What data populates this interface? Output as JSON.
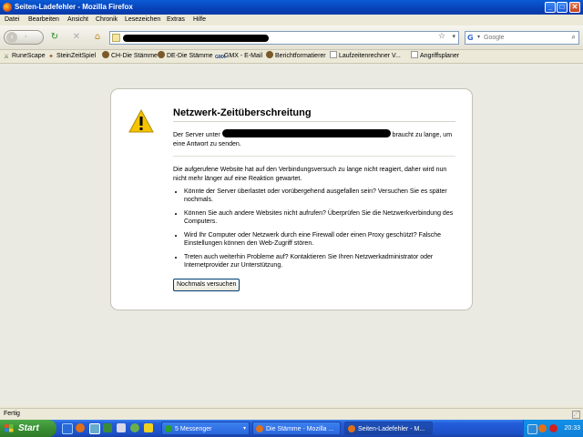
{
  "window": {
    "title": "Seiten-Ladefehler - Mozilla Firefox",
    "controls": {
      "minimize": "_",
      "maximize": "□",
      "close": "✕"
    }
  },
  "menu": [
    "Datei",
    "Bearbeiten",
    "Ansicht",
    "Chronik",
    "Lesezeichen",
    "Extras",
    "Hilfe"
  ],
  "search": {
    "placeholder": "Google"
  },
  "bookmarks": [
    {
      "label": "RuneScape",
      "icon": "runescape-icon"
    },
    {
      "label": "SteinZeitSpiel",
      "icon": "steinzeit-icon"
    },
    {
      "label": "CH-Die Stämme",
      "icon": "tribe-icon"
    },
    {
      "label": "DE-Die Stämme",
      "icon": "tribe-icon"
    },
    {
      "label": "GMX - E-Mail",
      "icon": "gmx-icon"
    },
    {
      "label": "Berichtformatierer",
      "icon": "tribe-icon"
    },
    {
      "label": "Laufzeitenrechner V... ",
      "icon": "page-icon"
    },
    {
      "label": "Angriffsplaner",
      "icon": "page-icon"
    }
  ],
  "error": {
    "title": "Netzwerk-Zeitüberschreitung",
    "desc_pre": "Der Server unter",
    "desc_post": "braucht zu lange, um eine Antwort zu senden.",
    "paragraph": "Die aufgerufene Website hat auf den Verbindungsversuch zu lange nicht reagiert, daher wird nun nicht mehr länger auf eine Reaktion gewartet.",
    "bullets": [
      "Könnte der Server überlastet oder vorübergehend ausgefallen sein? Versuchen Sie es später nochmals.",
      "Können Sie auch andere Websites nicht aufrufen? Überprüfen Sie die Netzwerkverbindung des Computers.",
      "Wird Ihr Computer oder Netzwerk durch eine Firewall oder einen Proxy geschützt? Falsche Einstellungen können den Web-Zugriff stören.",
      "Treten auch weiterhin Probleme auf? Kontaktieren Sie Ihren Netzwerkadministrator oder Internetprovider zur Unterstützung."
    ],
    "retry_label": "Nochmals versuchen"
  },
  "status": {
    "text": "Fertig"
  },
  "taskbar": {
    "start_label": "Start",
    "tasks": [
      {
        "label": "5 Messenger",
        "icon_color": "#2aa02a"
      },
      {
        "label": "Die Stämme - Mozilla ...",
        "icon_color": "#e0701a"
      },
      {
        "label": "Seiten-Ladefehler - M...",
        "icon_color": "#e0701a"
      }
    ],
    "clock": "20:33"
  },
  "colors": {
    "accent": "#0a5bd6",
    "warning": "#f5c400"
  }
}
